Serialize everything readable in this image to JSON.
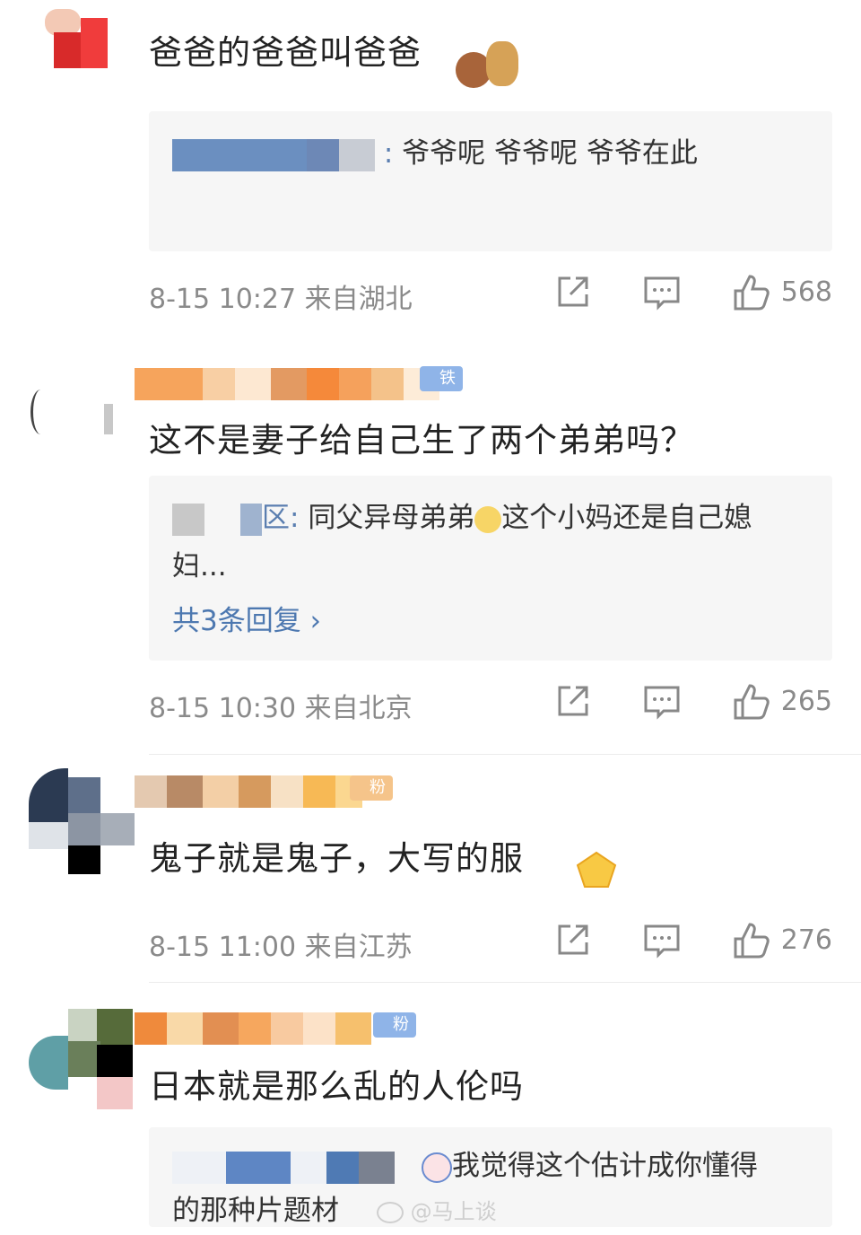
{
  "comments": [
    {
      "content": "爸爸的爸爸叫爸爸",
      "reply_lines": [
        "爷爷呢  爷爷呢  爷爷在此"
      ],
      "reply_prefix": ":",
      "more": "",
      "time": "8-15 10:27",
      "location": "来自湖北",
      "likes": "568"
    },
    {
      "badge": "铁粉5",
      "content": "这不是妻子给自己生了两个弟弟吗？",
      "reply_prefix": "区:",
      "reply_line1": "同父异母弟弟",
      "reply_line1b": "这个小妈还是自己媳",
      "reply_line2": "妇...",
      "more": "共3条回复 ›",
      "time": "8-15 10:30",
      "location": "来自北京",
      "likes": "265"
    },
    {
      "badge": "粉1",
      "content": "鬼子就是鬼子，大写的服",
      "time": "8-15 11:00",
      "location": "来自江苏",
      "likes": "276"
    },
    {
      "badge": "粉2",
      "content": "日本就是那么乱的人伦吗",
      "reply_line1": "我觉得这个估计成你懂得",
      "reply_line2": "的那种片题材"
    }
  ],
  "watermark": "@马上谈",
  "icons": {
    "share": "share-icon",
    "comment": "comment-icon",
    "like": "thumbs-up-icon"
  },
  "colors": {
    "link": "#4d78b0",
    "meta": "#8a8a8a",
    "reply_bg": "#f6f6f6",
    "badge_blue": "#8fb4e8"
  }
}
